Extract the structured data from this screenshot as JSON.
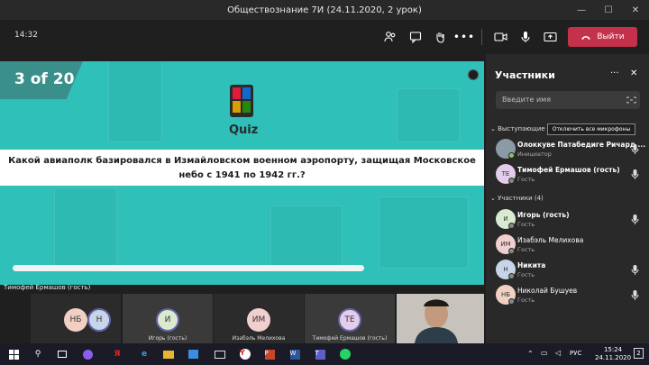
{
  "window": {
    "title": "Обществознание 7И (24.11.2020, 2 урок)",
    "minimize": "—",
    "maximize": "☐",
    "close": "✕"
  },
  "toolbar": {
    "time": "14:32",
    "leave_label": "Выйти"
  },
  "quiz": {
    "counter": "3 of 20",
    "brand": "Quiz",
    "question": "Какой авиаполк базировался в Измайловском военном аэропорту, защищая Московское небо с 1941 по 1942 гг.?"
  },
  "presenter_name": "Тимофей Ермашов (гость)",
  "tiles": [
    {
      "initials": "НБ",
      "name": "",
      "color": "#f1d0c3"
    },
    {
      "initials": "Н",
      "name": "",
      "color": "#c8d4e8"
    },
    {
      "initials": "И",
      "name": "Игорь (гость)",
      "color": "#d9ead0"
    },
    {
      "initials": "ИМ",
      "name": "Изабэль Мелихова",
      "color": "#f2cfcf"
    },
    {
      "initials": "ТЕ",
      "name": "Тимофей Ермашов (гость)",
      "color": "#e3cdea"
    }
  ],
  "panel": {
    "title": "Участники",
    "search_placeholder": "Введите имя",
    "presenters_header": "Выступающие (2)",
    "mute_all": "Отключить все микрофоны",
    "attendees_header": "Участники (4)",
    "presenters": [
      {
        "initials": "",
        "name": "Олоккуве Патабедиге Ричард ...",
        "role": "Инициатор",
        "color": "#8a9aa6"
      },
      {
        "initials": "ТЕ",
        "name": "Тимофей Ермашов (гость)",
        "role": "Гость",
        "color": "#e3cdea"
      }
    ],
    "attendees": [
      {
        "initials": "И",
        "name": "Игорь (гость)",
        "role": "Гость",
        "color": "#d9ead0"
      },
      {
        "initials": "ИМ",
        "name": "Изабэль Мелихова",
        "role": "Гость",
        "color": "#f2cfcf"
      },
      {
        "initials": "Н",
        "name": "Никита",
        "role": "Гость",
        "color": "#c8d4e8"
      },
      {
        "initials": "НБ",
        "name": "Николай Бушуев",
        "role": "Гость",
        "color": "#f1d0c3"
      }
    ]
  },
  "taskbar": {
    "lang": "РУС",
    "time": "15:24",
    "date": "24.11.2020",
    "notifications": "2"
  }
}
